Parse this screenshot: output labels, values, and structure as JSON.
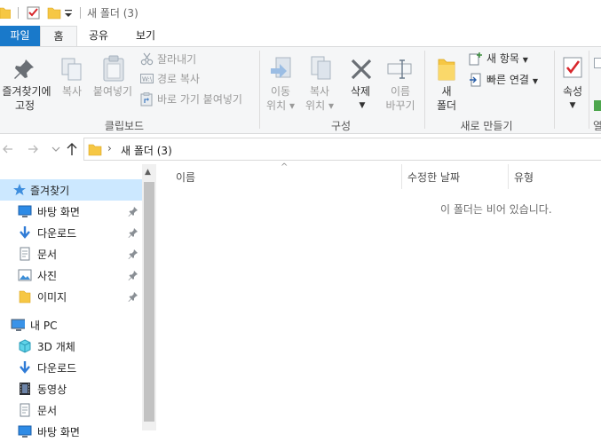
{
  "window": {
    "title": "새 폴더 (3)"
  },
  "tabs": [
    {
      "label": "파일",
      "active": false,
      "file": true
    },
    {
      "label": "홈",
      "active": true
    },
    {
      "label": "공유",
      "active": false
    },
    {
      "label": "보기",
      "active": false
    }
  ],
  "ribbon": {
    "clipboard": {
      "pin_label_1": "즐겨찾기에",
      "pin_label_2": "고정",
      "copy_label": "복사",
      "paste_label": "붙여넣기",
      "cut_label": "잘라내기",
      "copy_path_label": "경로 복사",
      "paste_shortcut_label": "바로 가기 붙여넣기",
      "group_label": "클립보드"
    },
    "organize": {
      "move_label_1": "이동",
      "move_label_2": "위치",
      "copyto_label_1": "복사",
      "copyto_label_2": "위치",
      "delete_label": "삭제",
      "rename_label_1": "이름",
      "rename_label_2": "바꾸기",
      "group_label": "구성"
    },
    "new": {
      "folder_label_1": "새",
      "folder_label_2": "폴더",
      "new_item_label": "새 항목",
      "easy_access_label": "빠른 연결",
      "group_label": "새로 만들기"
    },
    "open": {
      "properties_label": "속성",
      "group_label_partial": "열"
    }
  },
  "address": {
    "path": "새 폴더 (3)"
  },
  "nav": {
    "quick_access": "즐겨찾기",
    "pinned": [
      {
        "label": "바탕 화면",
        "icon": "desktop-icon"
      },
      {
        "label": "다운로드",
        "icon": "download-icon"
      },
      {
        "label": "문서",
        "icon": "document-icon"
      },
      {
        "label": "사진",
        "icon": "pictures-icon"
      },
      {
        "label": "이미지",
        "icon": "folder-icon"
      }
    ],
    "this_pc": "내 PC",
    "pc_items": [
      {
        "label": "3D 개체",
        "icon": "3d-objects-icon"
      },
      {
        "label": "다운로드",
        "icon": "download-icon"
      },
      {
        "label": "동영상",
        "icon": "video-icon"
      },
      {
        "label": "문서",
        "icon": "document-icon"
      },
      {
        "label": "바탕 화면",
        "icon": "desktop-icon"
      }
    ]
  },
  "columns": {
    "name": "이름",
    "modified": "수정한 날짜",
    "type": "유형"
  },
  "empty_message": "이 폴더는 비어 있습니다.",
  "colors": {
    "file_tab": "#1979ca",
    "selected_nav": "#cce8ff",
    "accent_blue": "#1f6fd1",
    "folder": "#f6c744"
  }
}
